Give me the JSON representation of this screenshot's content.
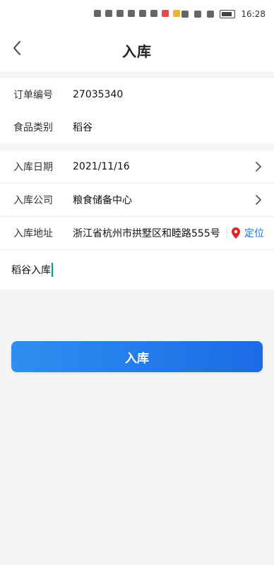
{
  "status_bar": {
    "time": "16:28",
    "icons": [
      "hd-icon",
      "signal-icon",
      "wifi-icon",
      "ring-icon",
      "shield-icon",
      "translate-icon",
      "red-app-icon",
      "yellow-app-icon",
      "alarm-icon",
      "bluetooth-icon",
      "vibrate-icon",
      "battery-icon"
    ]
  },
  "header": {
    "title": "入库",
    "back_icon": "chevron-left-icon"
  },
  "order_info": {
    "order_no_label": "订单编号",
    "order_no_value": "27035340",
    "food_type_label": "食品类别",
    "food_type_value": "稻谷"
  },
  "details": {
    "date_label": "入库日期",
    "date_value": "2021/11/16",
    "company_label": "入库公司",
    "company_value": "粮食储备中心",
    "address_label": "入库地址",
    "address_value": "浙江省杭州市拱墅区和睦路555号",
    "locate_label": "定位"
  },
  "note": {
    "text": "稻谷入库"
  },
  "actions": {
    "submit_label": "入库"
  },
  "colors": {
    "primary": "#1b6be5",
    "accent_text": "#1a73e8",
    "location_pin": "#e0242a",
    "caret": "#0a9b8a"
  }
}
